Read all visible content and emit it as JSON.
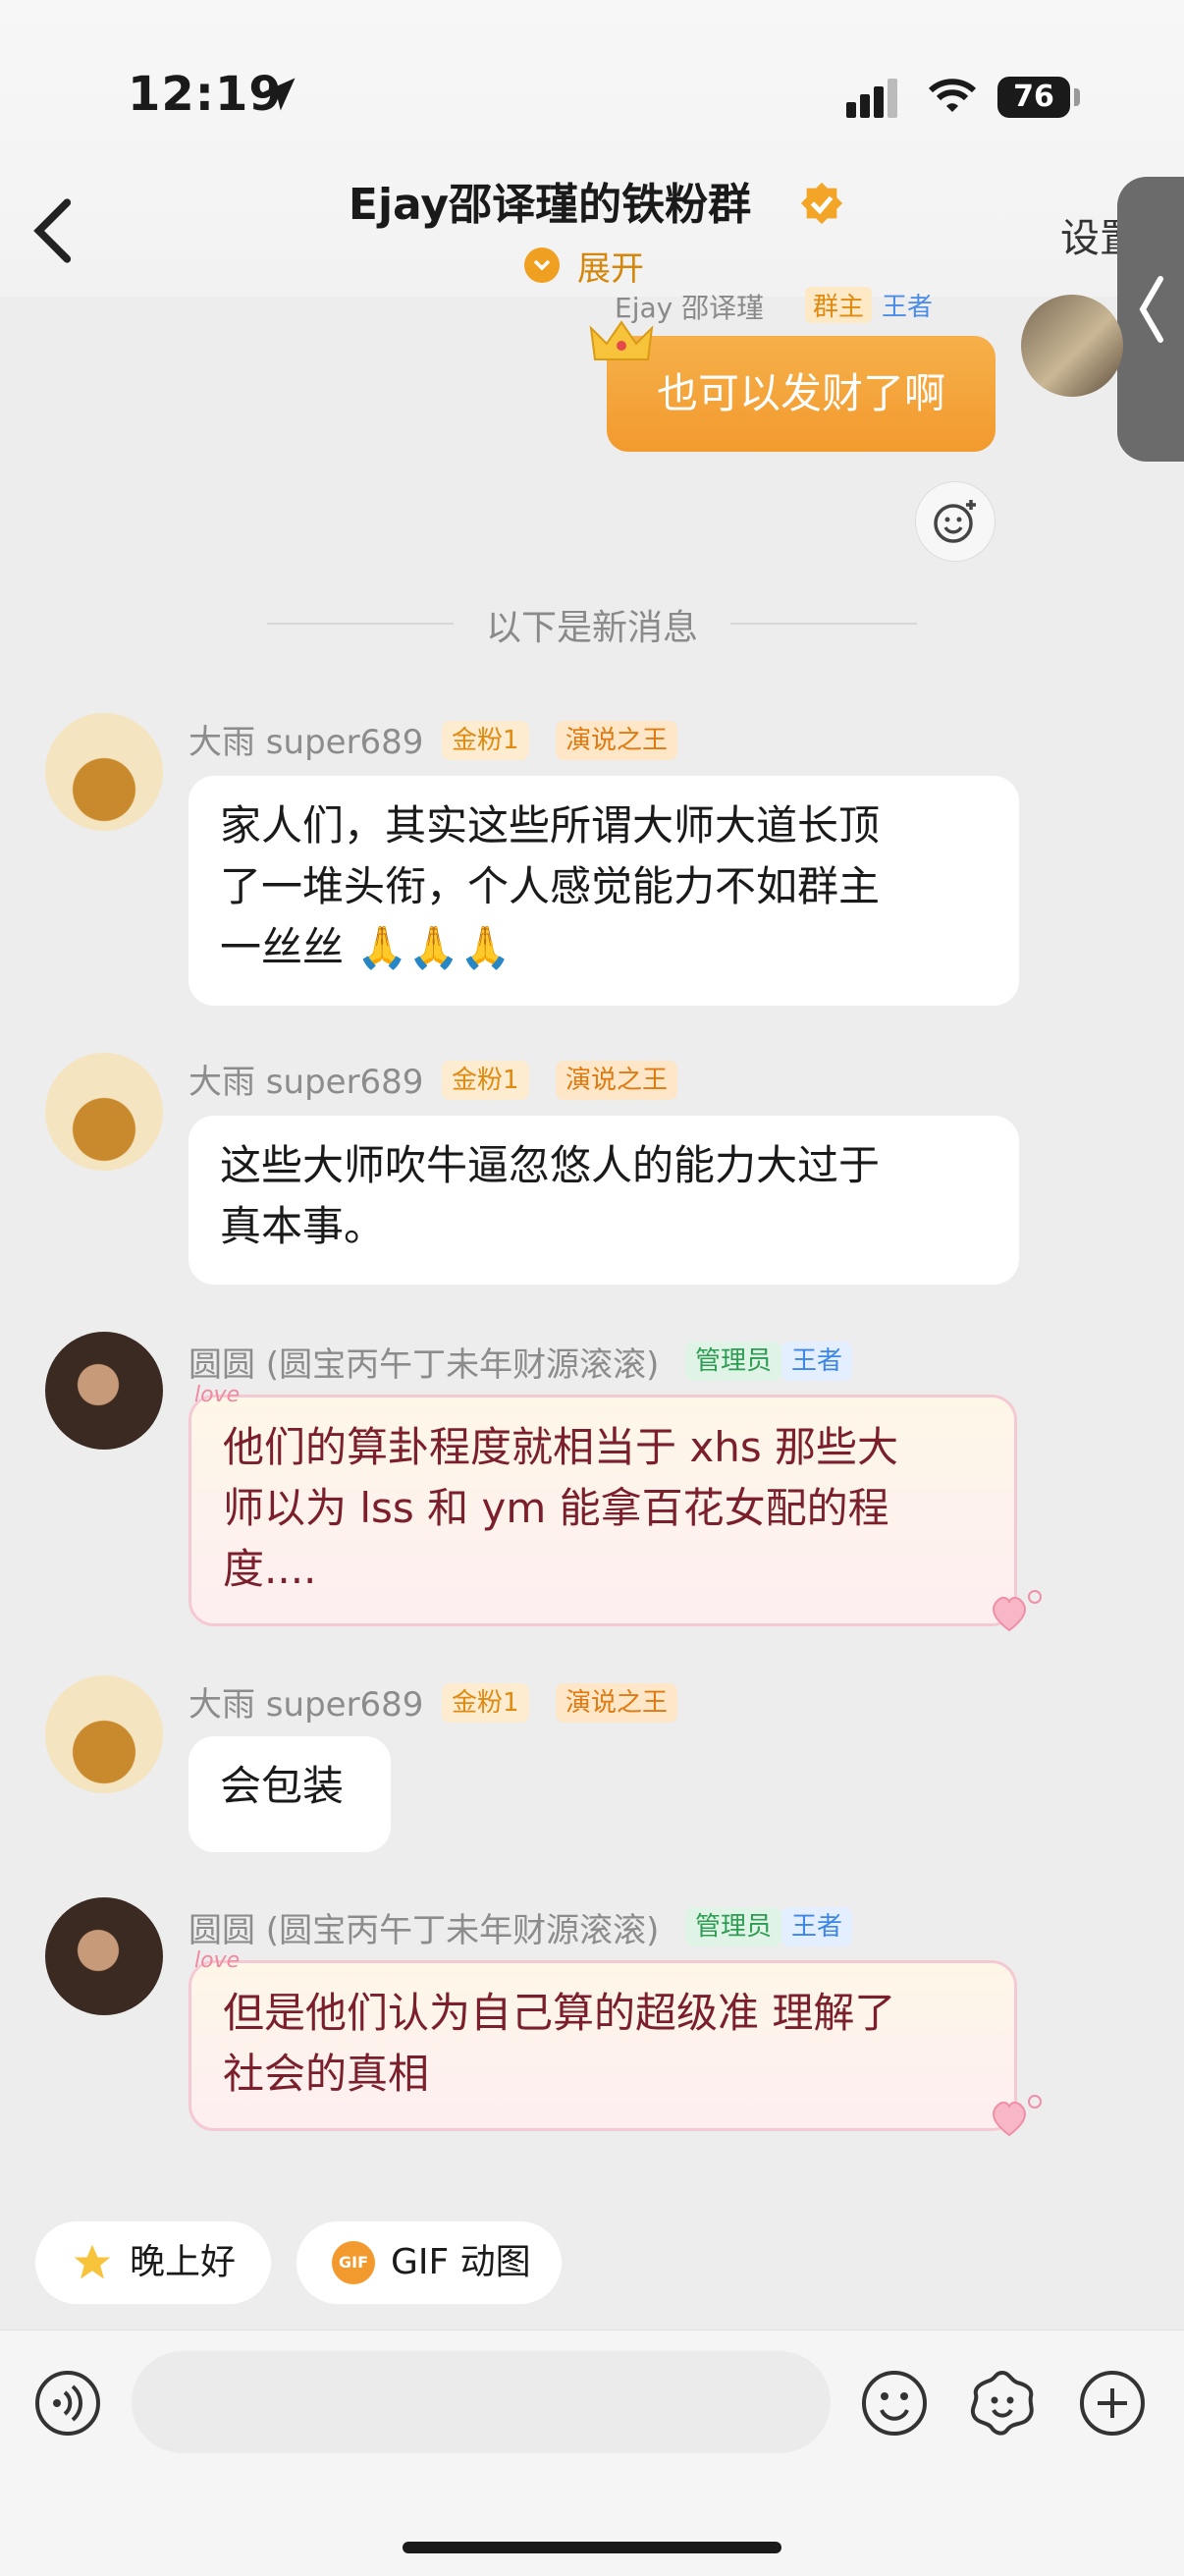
{
  "status_bar": {
    "time": "12:19",
    "battery": "76"
  },
  "header": {
    "title": "Ejay邵译瑾的铁粉群",
    "expand_label": "展开",
    "settings_label": "设置"
  },
  "own_message": {
    "sender": "Ejay 邵译瑾",
    "badges": [
      "群主",
      "王者"
    ],
    "text": "也可以发财了啊"
  },
  "divider": {
    "text": "以下是新消息"
  },
  "messages": [
    {
      "sender": "大雨 super689",
      "badges": [
        "金粉1",
        "演说之王"
      ],
      "lines": [
        "家人们，其实这些所谓大师大道长顶",
        "了一堆头衔，个人感觉能力不如群主",
        "一丝丝"
      ],
      "emojis": [
        "🙏",
        "🙏",
        "🙏"
      ]
    },
    {
      "sender": "大雨 super689",
      "badges": [
        "金粉1",
        "演说之王"
      ],
      "lines": [
        "这些大师吹牛逼忽悠人的能力大过于",
        "真本事。"
      ]
    },
    {
      "sender": "圆圆 (圆宝丙午丁未年财源滚滚)",
      "badges": [
        "管理员",
        "王者"
      ],
      "lines": [
        "他们的算卦程度就相当于 xhs 那些大",
        "师以为 lss 和 ym 能拿百花女配的程",
        "度...."
      ],
      "love_tag": "love"
    },
    {
      "sender": "大雨 super689",
      "badges": [
        "金粉1",
        "演说之王"
      ],
      "lines": [
        "会包装"
      ]
    },
    {
      "sender": "圆圆 (圆宝丙午丁未年财源滚滚)",
      "badges": [
        "管理员",
        "王者"
      ],
      "lines": [
        "但是他们认为自己算的超级准 理解了",
        "社会的真相"
      ],
      "love_tag": "love"
    }
  ],
  "quick_replies": [
    {
      "label": "晚上好",
      "icon": "star-emoji-icon"
    },
    {
      "label": "GIF 动图",
      "icon": "gif-icon"
    }
  ],
  "colors": {
    "accent": "#f29a2e",
    "background": "#ededed"
  }
}
